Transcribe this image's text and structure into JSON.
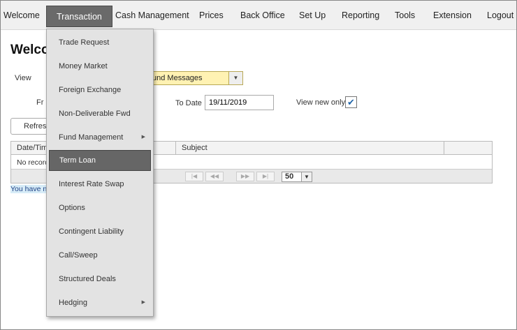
{
  "nav": {
    "items": [
      "Welcome",
      "Transaction",
      "Cash Management",
      "Prices",
      "Back Office",
      "Set Up",
      "Reporting",
      "Tools",
      "Extension",
      "Logout"
    ],
    "active": "Transaction"
  },
  "page": {
    "title": "Welco",
    "view_label": "View",
    "view_value": "und Messages",
    "from_label": "Fr",
    "to_date_label": "To Date",
    "to_date_value": "19/11/2019",
    "view_new_only_label": "View new only",
    "view_new_only_checked": true,
    "refresh_label": "Refresh"
  },
  "grid": {
    "columns": [
      "Date/Tim",
      "Subject"
    ],
    "empty_text": "No record",
    "page_size": "50",
    "footer_note": "You have no"
  },
  "menu": {
    "items": [
      {
        "label": "Trade Request",
        "submenu": false
      },
      {
        "label": "Money Market",
        "submenu": false
      },
      {
        "label": "Foreign Exchange",
        "submenu": false
      },
      {
        "label": "Non-Deliverable Fwd",
        "submenu": false
      },
      {
        "label": "Fund Management",
        "submenu": true
      },
      {
        "label": "Term Loan",
        "submenu": false,
        "highlighted": true
      },
      {
        "label": "Interest Rate Swap",
        "submenu": false
      },
      {
        "label": "Options",
        "submenu": false
      },
      {
        "label": "Contingent Liability",
        "submenu": false
      },
      {
        "label": "Call/Sweep",
        "submenu": false
      },
      {
        "label": "Structured Deals",
        "submenu": false
      },
      {
        "label": "Hedging",
        "submenu": true
      }
    ]
  },
  "icons": {
    "view_dropdown": "chevron-down-icon",
    "checkbox": "check-icon",
    "submenu": "caret-right-icon",
    "pager": [
      "first-page-icon",
      "prev-page-icon",
      "next-page-icon",
      "last-page-icon"
    ]
  }
}
